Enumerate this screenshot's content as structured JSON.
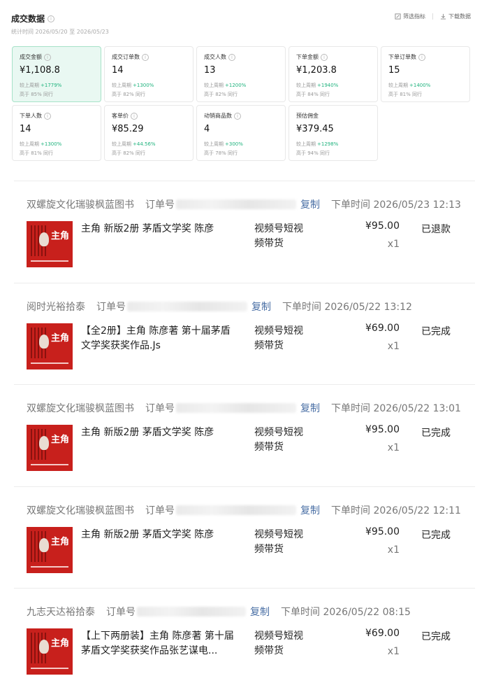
{
  "header": {
    "title": "成交数据",
    "subtitle": "统计时间 2026/05/20 至 2026/05/23",
    "filter_label": "筛选指标",
    "download_label": "下载数据"
  },
  "metrics": [
    {
      "label": "成交金额",
      "value": "¥1,108.8",
      "cmp_label": "较上周期",
      "cmp_value": "+1779%",
      "rank": "高于 85% 同行",
      "active": true
    },
    {
      "label": "成交订单数",
      "value": "14",
      "cmp_label": "较上周期",
      "cmp_value": "+1300%",
      "rank": "高于 82% 同行"
    },
    {
      "label": "成交人数",
      "value": "13",
      "cmp_label": "较上周期",
      "cmp_value": "+1200%",
      "rank": "高于 82% 同行"
    },
    {
      "label": "下单金额",
      "value": "¥1,203.8",
      "cmp_label": "较上周期",
      "cmp_value": "+1940%",
      "rank": "高于 84% 同行"
    },
    {
      "label": "下单订单数",
      "value": "15",
      "cmp_label": "较上周期",
      "cmp_value": "+1400%",
      "rank": "高于 81% 同行"
    },
    {
      "label": "下单人数",
      "value": "14",
      "cmp_label": "较上周期",
      "cmp_value": "+1300%",
      "rank": "高于 81% 同行"
    },
    {
      "label": "客单价",
      "value": "¥85.29",
      "cmp_label": "较上周期",
      "cmp_value": "+44.56%",
      "rank": "高于 82% 同行"
    },
    {
      "label": "动销商品数",
      "value": "4",
      "cmp_label": "较上周期",
      "cmp_value": "+300%",
      "rank": "高于 78% 同行"
    },
    {
      "label": "预估佣金",
      "value": "¥379.45",
      "cmp_label": "较上周期",
      "cmp_value": "+1298%",
      "rank": "高于 94% 同行"
    }
  ],
  "thumb_word": "主角",
  "orders": [
    {
      "shop": "双螺旋文化瑞骏枫蓝图书",
      "order_label": "订单号",
      "copy": "复制",
      "time": "下单时间 2026/05/23 12:13",
      "product": "主角 新版2册 茅盾文学奖 陈彦",
      "channel": "视频号短视频带货",
      "price": "¥95.00",
      "qty": "x1",
      "status": "已退款"
    },
    {
      "shop": "阅时光裕拾泰",
      "order_label": "订单号",
      "copy": "复制",
      "time": "下单时间 2026/05/22 13:12",
      "product": "【全2册】主角 陈彦著 第十届茅盾文学奖获奖作品.Js",
      "channel": "视频号短视频带货",
      "price": "¥69.00",
      "qty": "x1",
      "status": "已完成"
    },
    {
      "shop": "双螺旋文化瑞骏枫蓝图书",
      "order_label": "订单号",
      "copy": "复制",
      "time": "下单时间 2026/05/22 13:01",
      "product": "主角 新版2册 茅盾文学奖 陈彦",
      "channel": "视频号短视频带货",
      "price": "¥95.00",
      "qty": "x1",
      "status": "已完成"
    },
    {
      "shop": "双螺旋文化瑞骏枫蓝图书",
      "order_label": "订单号",
      "copy": "复制",
      "time": "下单时间 2026/05/22 12:11",
      "product": "主角 新版2册 茅盾文学奖 陈彦",
      "channel": "视频号短视频带货",
      "price": "¥95.00",
      "qty": "x1",
      "status": "已完成"
    },
    {
      "shop": "九志天达裕拾泰",
      "order_label": "订单号",
      "copy": "复制",
      "time": "下单时间 2026/05/22 08:15",
      "product": "【上下两册装】主角 陈彦著 第十届茅盾文学奖获奖作品张艺谋电...",
      "channel": "视频号短视频带货",
      "price": "¥69.00",
      "qty": "x1",
      "status": "已完成"
    }
  ]
}
